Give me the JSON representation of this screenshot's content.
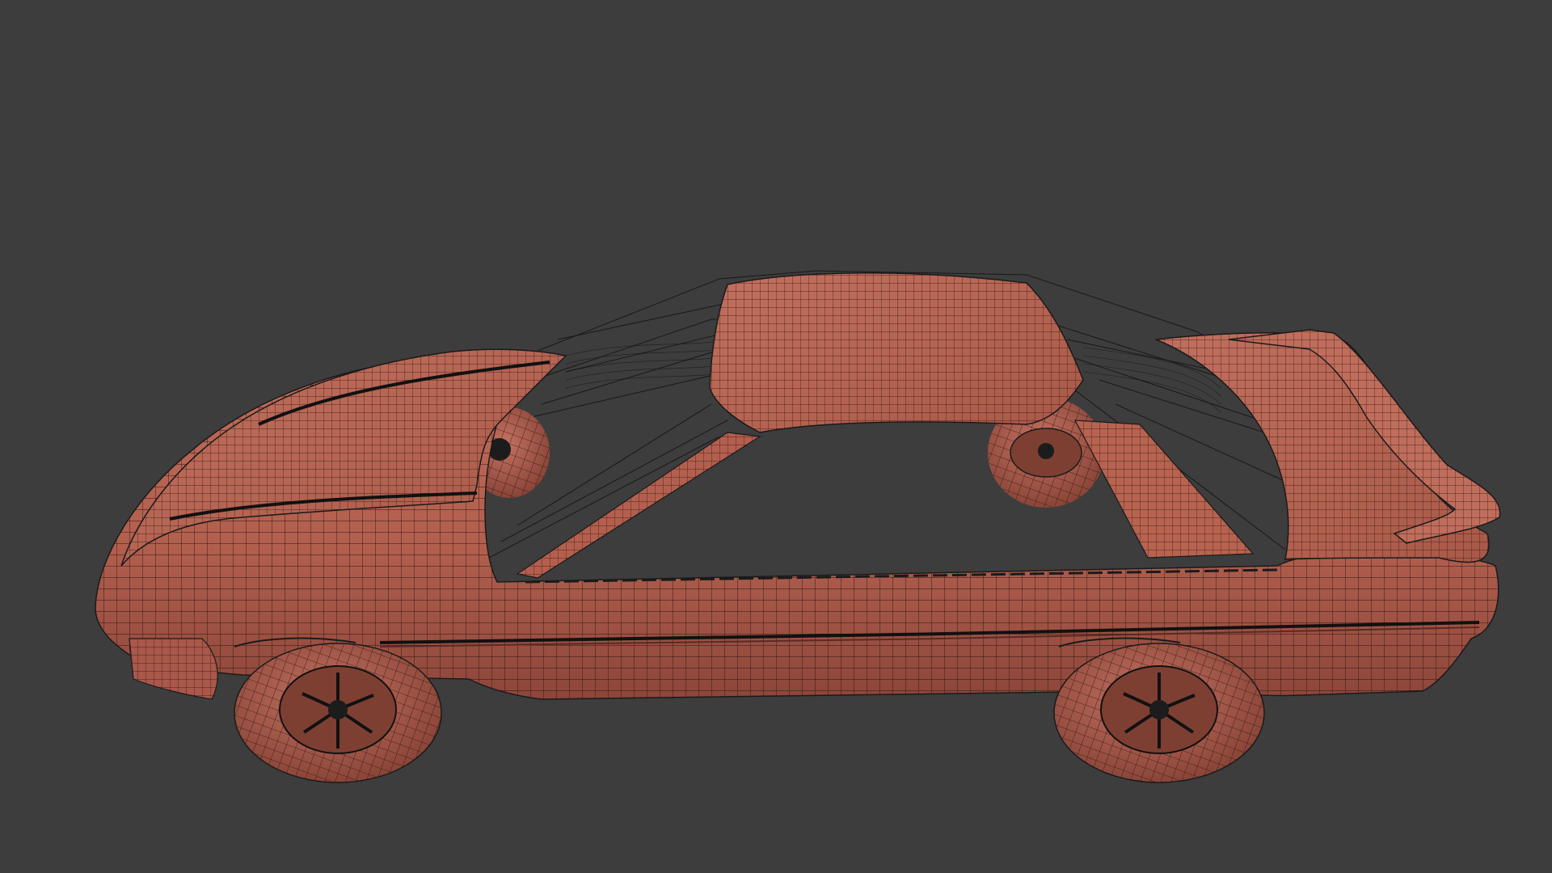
{
  "viewport": {
    "background": "#3d3d3d",
    "model": {
      "kind": "car-wireframe",
      "shading": "solid-with-wireframe",
      "surface_color": "#b4604f",
      "surface_shadow": "#7a3a30",
      "wire_color": "#1a1a1a"
    }
  }
}
